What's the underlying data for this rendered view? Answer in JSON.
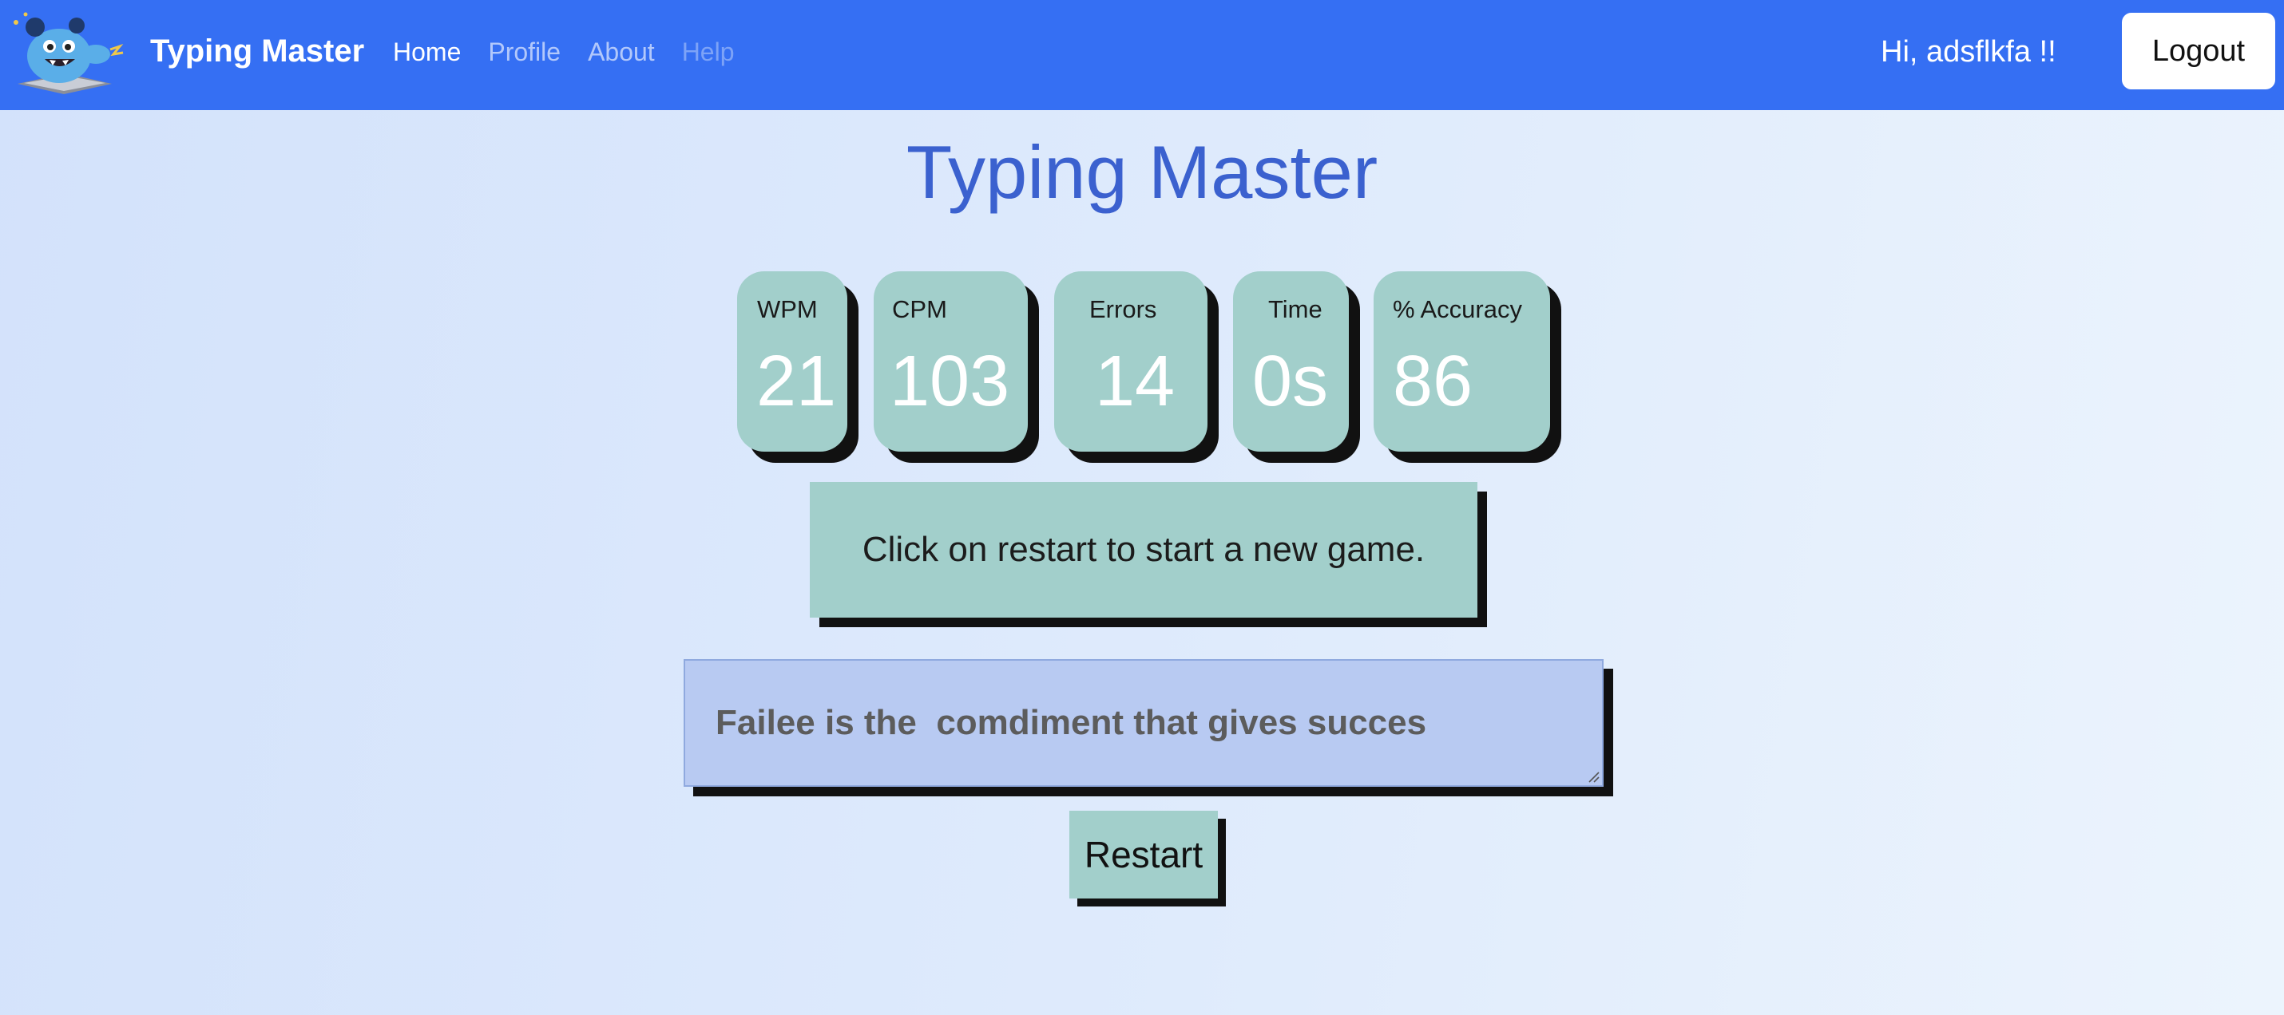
{
  "navbar": {
    "logo_icon": "monster-mascot-icon",
    "brand": "Typing Master",
    "links": [
      {
        "label": "Home",
        "state": "active"
      },
      {
        "label": "Profile",
        "state": "inactive"
      },
      {
        "label": "About",
        "state": "inactive"
      },
      {
        "label": "Help",
        "state": "disabled"
      }
    ],
    "greeting": "Hi, adsflkfa !!",
    "logout_label": "Logout"
  },
  "main": {
    "title": "Typing Master",
    "stats": {
      "wpm": {
        "label": "WPM",
        "value": "21"
      },
      "cpm": {
        "label": "CPM",
        "value": "103"
      },
      "errors": {
        "label": "Errors",
        "value": "14"
      },
      "time": {
        "label": "Time",
        "value": "0s"
      },
      "accuracy": {
        "label": "% Accuracy",
        "value": "86"
      }
    },
    "message": "Click on restart to start a new game.",
    "typed_text": "Failee is the  comdiment that gives succes",
    "restart_label": "Restart"
  },
  "colors": {
    "navbar": "#356ff3",
    "title": "#3b61cf",
    "card": "#a2cfcb",
    "textarea": "#b8caf2",
    "shadow": "#111111"
  }
}
